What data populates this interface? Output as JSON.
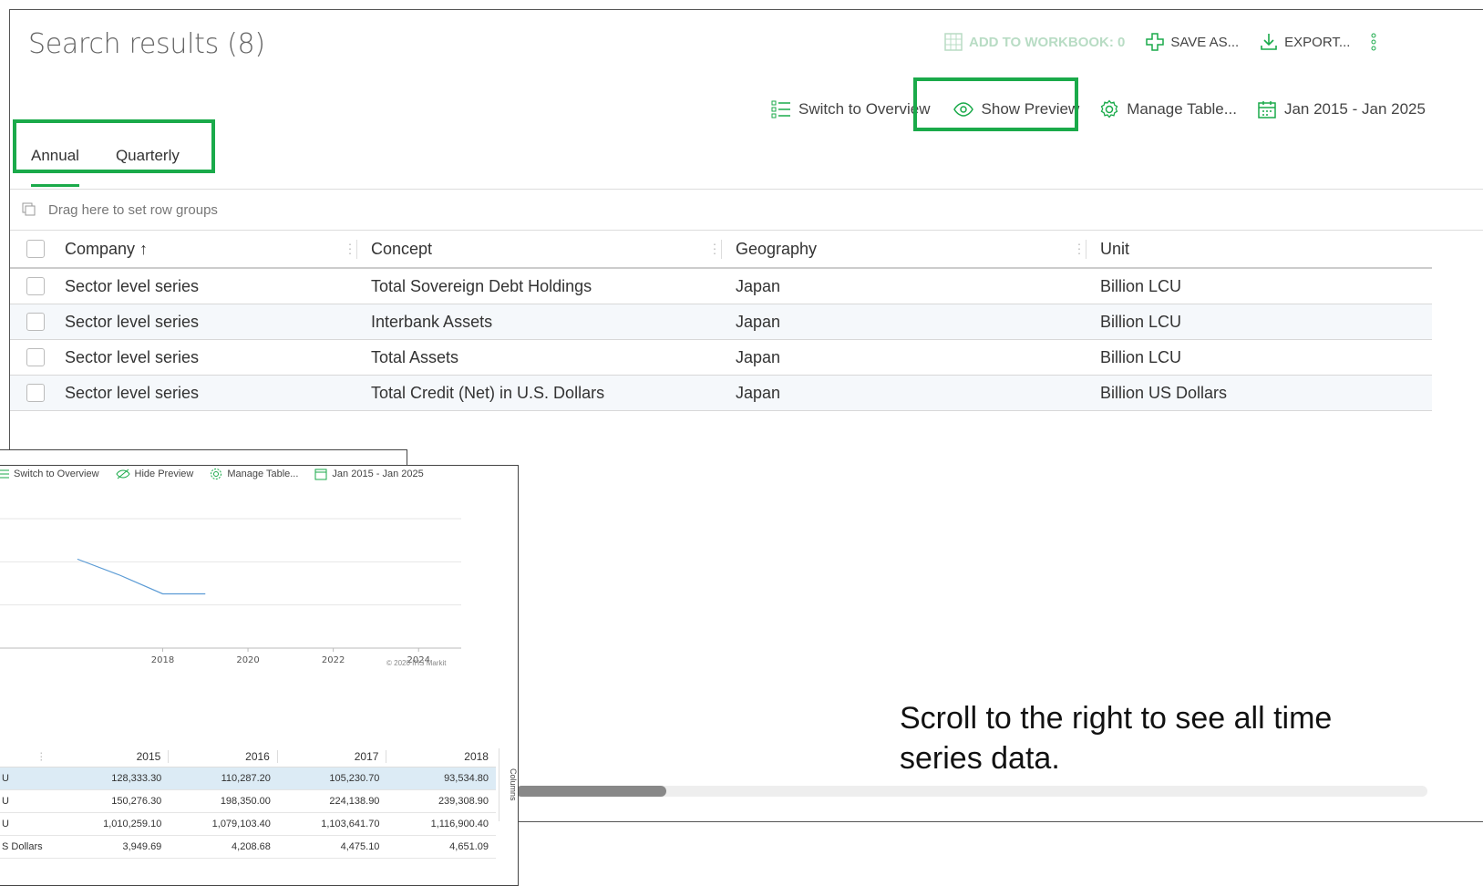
{
  "header": {
    "title": "Search results (8)",
    "add_to_workbook": "ADD TO WORKBOOK: 0",
    "save_as": "SAVE AS...",
    "export": "EXPORT..."
  },
  "view_toolbar": {
    "switch_overview": "Switch to Overview",
    "show_preview": "Show Preview",
    "manage_table": "Manage Table...",
    "date_range": "Jan 2015 - Jan 2025"
  },
  "tabs": [
    {
      "label": "Annual",
      "active": true
    },
    {
      "label": "Quarterly",
      "active": false
    }
  ],
  "group_bar": {
    "placeholder": "Drag here to set row groups"
  },
  "grid": {
    "columns": [
      "Company ↑",
      "Concept",
      "Geography",
      "Unit"
    ],
    "rows": [
      [
        "Sector level series",
        "Total Sovereign Debt Holdings",
        "Japan",
        "Billion LCU"
      ],
      [
        "Sector level series",
        "Interbank Assets",
        "Japan",
        "Billion LCU"
      ],
      [
        "Sector level series",
        "Total Assets",
        "Japan",
        "Billion LCU"
      ],
      [
        "Sector level series",
        "Total Credit (Net) in U.S. Dollars",
        "Japan",
        "Billion US Dollars"
      ]
    ]
  },
  "note": "Scroll to the right to see all time series data.",
  "preview": {
    "toolbar": {
      "switch_overview": "Switch to Overview",
      "hide_preview": "Hide Preview",
      "manage_table": "Manage Table...",
      "date_range": "Jan 2015 - Jan 2025"
    },
    "chart_data": {
      "type": "line",
      "x_ticks": [
        "2018",
        "2020",
        "2022",
        "2024"
      ],
      "series": [
        {
          "x": [
            2016,
            2017,
            2018,
            2019
          ],
          "values": [
            115000,
            105000,
            93534.8,
            93534.8
          ]
        }
      ],
      "copyright": "© 2020 IHS Markit"
    },
    "table": {
      "years": [
        "2015",
        "2016",
        "2017",
        "2018"
      ],
      "rows": [
        {
          "unit": "U",
          "values": [
            "128,333.30",
            "110,287.20",
            "105,230.70",
            "93,534.80"
          ]
        },
        {
          "unit": "U",
          "values": [
            "150,276.30",
            "198,350.00",
            "224,138.90",
            "239,308.90"
          ]
        },
        {
          "unit": "U",
          "values": [
            "1,010,259.10",
            "1,079,103.40",
            "1,103,641.70",
            "1,116,900.40"
          ]
        },
        {
          "unit": "S Dollars",
          "values": [
            "3,949.69",
            "4,208.68",
            "4,475.10",
            "4,651.09"
          ]
        }
      ],
      "side_label": "Columns"
    }
  },
  "colors": {
    "accent": "#1aaa4a",
    "highlight": "#1aaa4a",
    "line": "#5b9bd5"
  }
}
